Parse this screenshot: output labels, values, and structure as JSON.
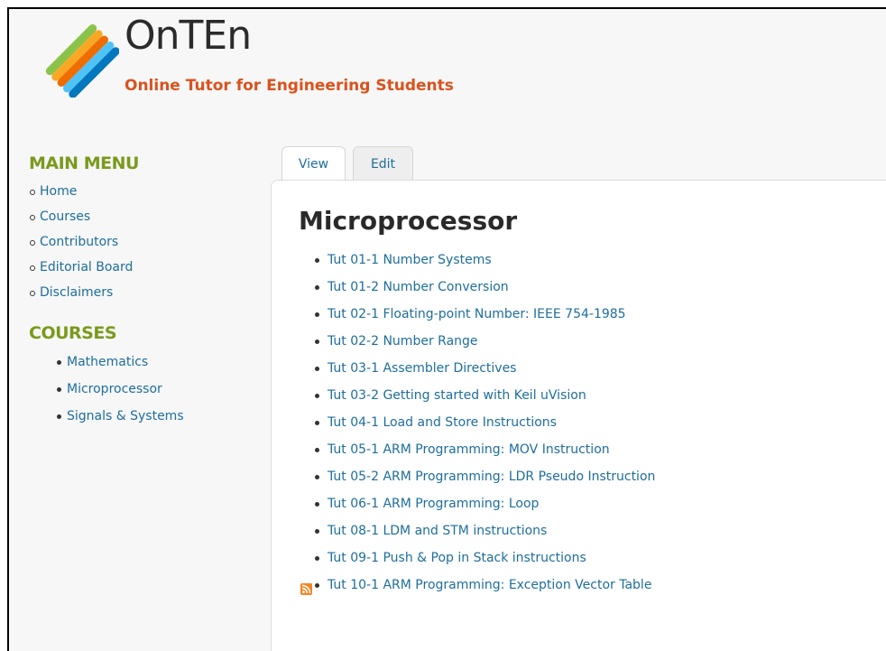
{
  "site": {
    "name": "OnTEn",
    "slogan": "Online Tutor for Engineering Students",
    "logo_icon": "diagonal-stripes-logo",
    "logo_colors": [
      "#7cb342",
      "#f9a825",
      "#e65100",
      "#4fc3f7",
      "#0288d1"
    ]
  },
  "sidebar": {
    "main_menu_title": "MAIN MENU",
    "main_menu": [
      {
        "label": "Home"
      },
      {
        "label": "Courses"
      },
      {
        "label": "Contributors"
      },
      {
        "label": "Editorial Board"
      },
      {
        "label": "Disclaimers"
      }
    ],
    "courses_title": "COURSES",
    "courses": [
      {
        "label": "Mathematics"
      },
      {
        "label": "Microprocessor"
      },
      {
        "label": "Signals & Systems"
      }
    ]
  },
  "tabs": [
    {
      "label": "View",
      "active": true
    },
    {
      "label": "Edit",
      "active": false
    }
  ],
  "main": {
    "title": "Microprocessor",
    "items": [
      {
        "label": "Tut 01-1 Number Systems"
      },
      {
        "label": "Tut 01-2 Number Conversion"
      },
      {
        "label": "Tut 02-1 Floating-point Number: IEEE 754-1985"
      },
      {
        "label": "Tut 02-2 Number Range"
      },
      {
        "label": "Tut 03-1 Assembler Directives"
      },
      {
        "label": "Tut 03-2 Getting started with Keil uVision"
      },
      {
        "label": "Tut 04-1 Load and Store Instructions"
      },
      {
        "label": "Tut 05-1 ARM Programming: MOV Instruction"
      },
      {
        "label": "Tut 05-2 ARM Programming: LDR Pseudo Instruction"
      },
      {
        "label": "Tut 06-1 ARM Programming: Loop"
      },
      {
        "label": "Tut 08-1 LDM and STM instructions"
      },
      {
        "label": "Tut 09-1 Push & Pop in Stack instructions"
      },
      {
        "label": "Tut 10-1 ARM Programming: Exception Vector Table"
      }
    ],
    "feed_icon": "rss-feed-icon"
  },
  "colors": {
    "link": "#1d6e9c",
    "block_title": "#7a9a1c",
    "slogan": "#d9531e",
    "rss": "#f78422"
  }
}
